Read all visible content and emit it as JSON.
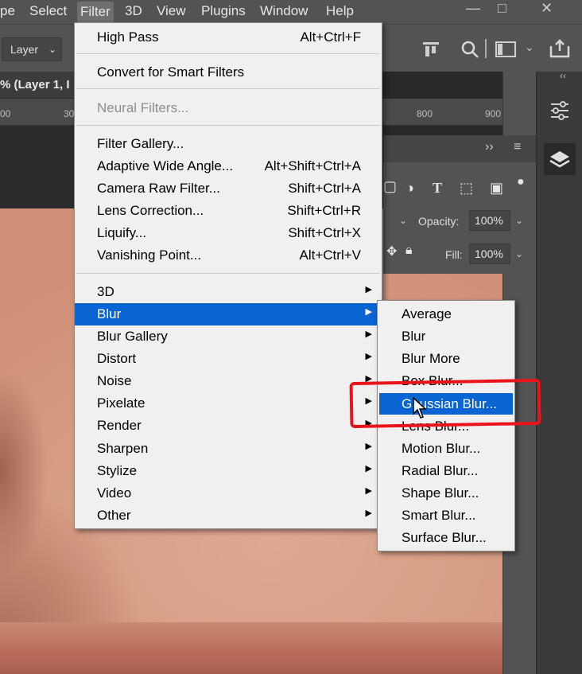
{
  "menubar": {
    "items": [
      "pe",
      "Select",
      "Filter",
      "3D",
      "View",
      "Plugins",
      "Window",
      "Help"
    ],
    "active": "Filter",
    "window_controls": [
      "—",
      "□",
      "✕"
    ]
  },
  "options": {
    "layer_select": "Layer"
  },
  "document": {
    "tab_title": "% (Layer 1, I",
    "ruler_ticks": [
      "00",
      "30",
      "800",
      "900"
    ]
  },
  "layers_panel": {
    "opacity_label": "Opacity:",
    "opacity_value": "100%",
    "fill_label": "Fill:",
    "fill_value": "100%"
  },
  "filter_menu": {
    "items": [
      {
        "label": "High Pass",
        "shortcut": "Alt+Ctrl+F"
      },
      {
        "label": "Convert for Smart Filters",
        "shortcut": ""
      },
      {
        "label": "Neural Filters...",
        "shortcut": "",
        "disabled": true
      },
      {
        "label": "Filter Gallery...",
        "shortcut": ""
      },
      {
        "label": "Adaptive Wide Angle...",
        "shortcut": "Alt+Shift+Ctrl+A"
      },
      {
        "label": "Camera Raw Filter...",
        "shortcut": "Shift+Ctrl+A"
      },
      {
        "label": "Lens Correction...",
        "shortcut": "Shift+Ctrl+R"
      },
      {
        "label": "Liquify...",
        "shortcut": "Shift+Ctrl+X"
      },
      {
        "label": "Vanishing Point...",
        "shortcut": "Alt+Ctrl+V"
      },
      {
        "label": "3D",
        "submenu": true
      },
      {
        "label": "Blur",
        "submenu": true,
        "highlighted": true
      },
      {
        "label": "Blur Gallery",
        "submenu": true
      },
      {
        "label": "Distort",
        "submenu": true
      },
      {
        "label": "Noise",
        "submenu": true
      },
      {
        "label": "Pixelate",
        "submenu": true
      },
      {
        "label": "Render",
        "submenu": true
      },
      {
        "label": "Sharpen",
        "submenu": true
      },
      {
        "label": "Stylize",
        "submenu": true
      },
      {
        "label": "Video",
        "submenu": true
      },
      {
        "label": "Other",
        "submenu": true
      }
    ]
  },
  "blur_submenu": {
    "items": [
      {
        "label": "Average"
      },
      {
        "label": "Blur"
      },
      {
        "label": "Blur More"
      },
      {
        "label": "Box Blur..."
      },
      {
        "label": "Gaussian Blur...",
        "highlighted": true
      },
      {
        "label": "Lens Blur..."
      },
      {
        "label": "Motion Blur..."
      },
      {
        "label": "Radial Blur..."
      },
      {
        "label": "Shape Blur..."
      },
      {
        "label": "Smart Blur..."
      },
      {
        "label": "Surface Blur..."
      }
    ]
  },
  "colors": {
    "menu_bg": "#f0f0f0",
    "highlight": "#0a64d2",
    "annotation_red": "#e8141a",
    "app_chrome": "#535353"
  }
}
